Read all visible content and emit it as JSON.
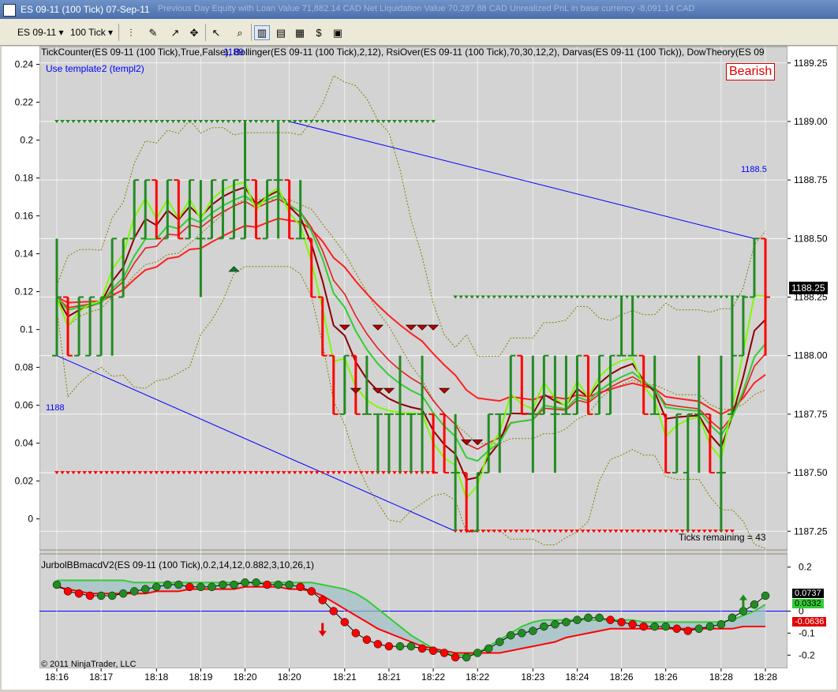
{
  "window": {
    "title": "ES 09-11 (100 Tick)  07-Sep-11",
    "header_stats": "Previous Day Equity with Loan Value  71,882.14 CAD   Net Liquidation Value  70,287.88 CAD   Unrealized PnL in base currency  -8,091.14 CAD"
  },
  "toolbar": {
    "instrument": "ES 09-11",
    "period": "100 Tick",
    "icons": [
      "bar-type-icon",
      "pencil-icon",
      "drawing-tools-icon",
      "snap-icon",
      "pointer-icon",
      "zoom-icon",
      "split-panel-icon",
      "chart-style-icon",
      "data-box-icon",
      "strategy-icon",
      "properties-icon"
    ]
  },
  "price_panel": {
    "indicators_label": "TickCounter(ES 09-11 (100 Tick),True,False), Bollinger(ES 09-11 (100 Tick),2,12), RsiOver(ES 09-11 (100 Tick),70,30,12,2), Darvas(ES 09-11 (100 Tick)), DowTheory(ES 09",
    "overlap_label": "1189",
    "template_label": "Use template2 (templ2)",
    "bearish_label": "Bearish",
    "ticks_remaining": "Ticks remaining = 43",
    "trendline_upper_label": "1188.5",
    "trendline_lower_label": "1188",
    "last_price": "1188.25"
  },
  "macd_panel": {
    "label": "JurbolBBmacdV2(ES 09-11 (100 Tick),0.2,14,12,0.882,3,10,26,1)",
    "copyright": "© 2011 NinjaTrader, LLC",
    "value_1": "0.0737",
    "value_2": "0.0332",
    "value_3": "-0.0636"
  },
  "colors": {
    "up": "#228b22",
    "down": "#ff0000",
    "bright_green": "#7cfc00",
    "dark_red": "#8b0000",
    "trendline": "#0000ff",
    "bollinger": "#808000",
    "background": "#d3d3d3"
  },
  "chart_data": [
    {
      "type": "bar",
      "name": "ES 09-11 (100 Tick) price",
      "y_right_ticks": [
        "1189.25",
        "1189.00",
        "1188.75",
        "1188.50",
        "1188.25",
        "1188.00",
        "1187.75",
        "1187.50",
        "1187.25"
      ],
      "y_left_ticks": [
        "0.24",
        "0.22",
        "0.2",
        "0.18",
        "0.16",
        "0.14",
        "0.12",
        "0.1",
        "0.08",
        "0.06",
        "0.04",
        "0.02",
        "0"
      ],
      "ylim": [
        1187.17,
        1189.32
      ],
      "bars": [
        {
          "o": 1188.0,
          "h": 1188.5,
          "l": 1188.0,
          "c": 1188.25
        },
        {
          "o": 1188.25,
          "h": 1188.25,
          "l": 1188.0,
          "c": 1188.0
        },
        {
          "o": 1188.0,
          "h": 1188.25,
          "l": 1188.0,
          "c": 1188.25
        },
        {
          "o": 1188.0,
          "h": 1188.25,
          "l": 1188.0,
          "c": 1188.25
        },
        {
          "o": 1188.0,
          "h": 1188.25,
          "l": 1188.0,
          "c": 1188.25
        },
        {
          "o": 1188.25,
          "h": 1188.5,
          "l": 1188.0,
          "c": 1188.5
        },
        {
          "o": 1188.25,
          "h": 1188.5,
          "l": 1188.25,
          "c": 1188.5
        },
        {
          "o": 1188.5,
          "h": 1188.75,
          "l": 1188.5,
          "c": 1188.75
        },
        {
          "o": 1188.5,
          "h": 1188.75,
          "l": 1188.5,
          "c": 1188.75
        },
        {
          "o": 1188.75,
          "h": 1188.75,
          "l": 1188.5,
          "c": 1188.5
        },
        {
          "o": 1188.5,
          "h": 1188.75,
          "l": 1188.5,
          "c": 1188.75
        },
        {
          "o": 1188.75,
          "h": 1188.75,
          "l": 1188.5,
          "c": 1188.5
        },
        {
          "o": 1188.5,
          "h": 1188.75,
          "l": 1188.5,
          "c": 1188.75
        },
        {
          "o": 1188.5,
          "h": 1188.75,
          "l": 1188.25,
          "c": 1188.5
        },
        {
          "o": 1188.5,
          "h": 1188.75,
          "l": 1188.5,
          "c": 1188.75
        },
        {
          "o": 1188.5,
          "h": 1188.75,
          "l": 1188.5,
          "c": 1188.75
        },
        {
          "o": 1188.5,
          "h": 1188.75,
          "l": 1188.5,
          "c": 1188.75
        },
        {
          "o": 1188.5,
          "h": 1189.0,
          "l": 1188.5,
          "c": 1188.75
        },
        {
          "o": 1188.75,
          "h": 1188.75,
          "l": 1188.5,
          "c": 1188.5
        },
        {
          "o": 1188.5,
          "h": 1188.75,
          "l": 1188.5,
          "c": 1188.75
        },
        {
          "o": 1188.75,
          "h": 1189.0,
          "l": 1188.5,
          "c": 1188.75
        },
        {
          "o": 1188.75,
          "h": 1188.75,
          "l": 1188.5,
          "c": 1188.5
        },
        {
          "o": 1188.5,
          "h": 1188.75,
          "l": 1188.5,
          "c": 1188.5
        },
        {
          "o": 1188.5,
          "h": 1188.5,
          "l": 1188.25,
          "c": 1188.25
        },
        {
          "o": 1188.25,
          "h": 1188.25,
          "l": 1188.0,
          "c": 1188.0
        },
        {
          "o": 1188.0,
          "h": 1188.0,
          "l": 1187.75,
          "c": 1187.75
        },
        {
          "o": 1187.75,
          "h": 1188.0,
          "l": 1187.75,
          "c": 1188.0
        },
        {
          "o": 1188.0,
          "h": 1188.0,
          "l": 1187.75,
          "c": 1187.75
        },
        {
          "o": 1187.75,
          "h": 1188.0,
          "l": 1187.75,
          "c": 1187.75
        },
        {
          "o": 1187.75,
          "h": 1187.75,
          "l": 1187.5,
          "c": 1187.75
        },
        {
          "o": 1187.75,
          "h": 1187.75,
          "l": 1187.5,
          "c": 1187.75
        },
        {
          "o": 1187.75,
          "h": 1188.0,
          "l": 1187.5,
          "c": 1187.75
        },
        {
          "o": 1187.75,
          "h": 1187.75,
          "l": 1187.5,
          "c": 1187.75
        },
        {
          "o": 1187.75,
          "h": 1188.0,
          "l": 1187.5,
          "c": 1187.75
        },
        {
          "o": 1187.75,
          "h": 1187.75,
          "l": 1187.5,
          "c": 1187.5
        },
        {
          "o": 1187.75,
          "h": 1187.75,
          "l": 1187.5,
          "c": 1187.5
        },
        {
          "o": 1187.5,
          "h": 1187.75,
          "l": 1187.25,
          "c": 1187.5
        },
        {
          "o": 1187.5,
          "h": 1187.5,
          "l": 1187.25,
          "c": 1187.25
        },
        {
          "o": 1187.25,
          "h": 1187.5,
          "l": 1187.25,
          "c": 1187.5
        },
        {
          "o": 1187.5,
          "h": 1187.75,
          "l": 1187.5,
          "c": 1187.75
        },
        {
          "o": 1187.75,
          "h": 1187.75,
          "l": 1187.5,
          "c": 1187.75
        },
        {
          "o": 1187.75,
          "h": 1188.0,
          "l": 1187.75,
          "c": 1188.0
        },
        {
          "o": 1188.0,
          "h": 1188.0,
          "l": 1187.75,
          "c": 1187.75
        },
        {
          "o": 1187.75,
          "h": 1188.0,
          "l": 1187.5,
          "c": 1187.75
        },
        {
          "o": 1187.75,
          "h": 1188.0,
          "l": 1187.75,
          "c": 1188.0
        },
        {
          "o": 1187.75,
          "h": 1188.0,
          "l": 1187.5,
          "c": 1187.75
        },
        {
          "o": 1187.75,
          "h": 1188.0,
          "l": 1187.75,
          "c": 1187.75
        },
        {
          "o": 1187.75,
          "h": 1188.0,
          "l": 1187.75,
          "c": 1188.0
        },
        {
          "o": 1188.0,
          "h": 1188.0,
          "l": 1187.75,
          "c": 1187.75
        },
        {
          "o": 1187.75,
          "h": 1188.0,
          "l": 1187.75,
          "c": 1188.0
        },
        {
          "o": 1187.75,
          "h": 1188.0,
          "l": 1187.75,
          "c": 1188.0
        },
        {
          "o": 1188.0,
          "h": 1188.25,
          "l": 1188.0,
          "c": 1188.0
        },
        {
          "o": 1188.0,
          "h": 1188.25,
          "l": 1188.0,
          "c": 1188.0
        },
        {
          "o": 1188.0,
          "h": 1188.0,
          "l": 1187.75,
          "c": 1187.75
        },
        {
          "o": 1187.75,
          "h": 1188.0,
          "l": 1187.75,
          "c": 1187.75
        },
        {
          "o": 1187.75,
          "h": 1187.75,
          "l": 1187.5,
          "c": 1187.5
        },
        {
          "o": 1187.5,
          "h": 1187.75,
          "l": 1187.5,
          "c": 1187.75
        },
        {
          "o": 1187.5,
          "h": 1187.75,
          "l": 1187.25,
          "c": 1187.75
        },
        {
          "o": 1187.75,
          "h": 1188.0,
          "l": 1187.5,
          "c": 1187.75
        },
        {
          "o": 1187.75,
          "h": 1187.75,
          "l": 1187.5,
          "c": 1187.5
        },
        {
          "o": 1187.5,
          "h": 1188.0,
          "l": 1187.25,
          "c": 1187.5
        },
        {
          "o": 1187.75,
          "h": 1188.25,
          "l": 1187.75,
          "c": 1188.0
        },
        {
          "o": 1188.0,
          "h": 1188.25,
          "l": 1188.0,
          "c": 1188.25
        },
        {
          "o": 1188.25,
          "h": 1188.5,
          "l": 1188.25,
          "c": 1188.5
        },
        {
          "o": 1188.5,
          "h": 1188.5,
          "l": 1188.0,
          "c": 1188.25
        }
      ],
      "x_tick_labels": [
        "18:16",
        "18:17",
        "18:18",
        "18:19",
        "18:20",
        "18:20",
        "18:21",
        "18:21",
        "18:22",
        "18:22",
        "18:23",
        "18:24",
        "18:26",
        "18:26",
        "18:28",
        "18:28"
      ]
    },
    {
      "type": "line",
      "name": "JurbolBBmacdV2",
      "y_ticks": [
        "0.2",
        "0",
        "-0.1",
        "-0.2"
      ],
      "ylim": [
        -0.26,
        0.26
      ],
      "series": [
        {
          "name": "macd",
          "values": [
            0.12,
            0.09,
            0.08,
            0.07,
            0.07,
            0.07,
            0.08,
            0.09,
            0.1,
            0.11,
            0.12,
            0.12,
            0.11,
            0.11,
            0.11,
            0.12,
            0.12,
            0.13,
            0.13,
            0.12,
            0.12,
            0.12,
            0.11,
            0.09,
            0.05,
            0.0,
            -0.05,
            -0.1,
            -0.13,
            -0.15,
            -0.16,
            -0.16,
            -0.16,
            -0.17,
            -0.18,
            -0.19,
            -0.21,
            -0.21,
            -0.19,
            -0.17,
            -0.14,
            -0.11,
            -0.1,
            -0.09,
            -0.07,
            -0.06,
            -0.05,
            -0.04,
            -0.03,
            -0.03,
            -0.04,
            -0.05,
            -0.06,
            -0.07,
            -0.07,
            -0.07,
            -0.08,
            -0.09,
            -0.08,
            -0.07,
            -0.06,
            -0.03,
            0.0,
            0.03,
            0.07
          ]
        },
        {
          "name": "signal",
          "values": [
            0.11,
            0.1,
            0.09,
            0.08,
            0.08,
            0.08,
            0.08,
            0.08,
            0.08,
            0.09,
            0.09,
            0.09,
            0.1,
            0.1,
            0.1,
            0.1,
            0.1,
            0.11,
            0.11,
            0.11,
            0.11,
            0.1,
            0.1,
            0.09,
            0.07,
            0.04,
            0.01,
            -0.02,
            -0.05,
            -0.08,
            -0.1,
            -0.12,
            -0.14,
            -0.16,
            -0.17,
            -0.18,
            -0.19,
            -0.19,
            -0.19,
            -0.19,
            -0.19,
            -0.18,
            -0.17,
            -0.16,
            -0.15,
            -0.14,
            -0.12,
            -0.11,
            -0.1,
            -0.09,
            -0.08,
            -0.08,
            -0.08,
            -0.08,
            -0.08,
            -0.08,
            -0.08,
            -0.08,
            -0.08,
            -0.08,
            -0.08,
            -0.08,
            -0.07,
            -0.07,
            -0.07
          ]
        },
        {
          "name": "upper_band",
          "values": [
            0.14,
            0.14,
            0.14,
            0.14,
            0.14,
            0.14,
            0.14,
            0.13,
            0.13,
            0.13,
            0.13,
            0.13,
            0.13,
            0.13,
            0.13,
            0.13,
            0.13,
            0.13,
            0.13,
            0.13,
            0.13,
            0.13,
            0.13,
            0.13,
            0.12,
            0.11,
            0.1,
            0.08,
            0.05,
            0.01,
            -0.03,
            -0.07,
            -0.11,
            -0.14,
            -0.17,
            -0.19,
            -0.2,
            -0.2,
            -0.19,
            -0.16,
            -0.13,
            -0.1,
            -0.07,
            -0.05,
            -0.04,
            -0.04,
            -0.04,
            -0.04,
            -0.04,
            -0.04,
            -0.04,
            -0.04,
            -0.04,
            -0.05,
            -0.05,
            -0.05,
            -0.05,
            -0.05,
            -0.05,
            -0.05,
            -0.05,
            -0.04,
            -0.02,
            0.0,
            0.03
          ]
        }
      ]
    }
  ]
}
